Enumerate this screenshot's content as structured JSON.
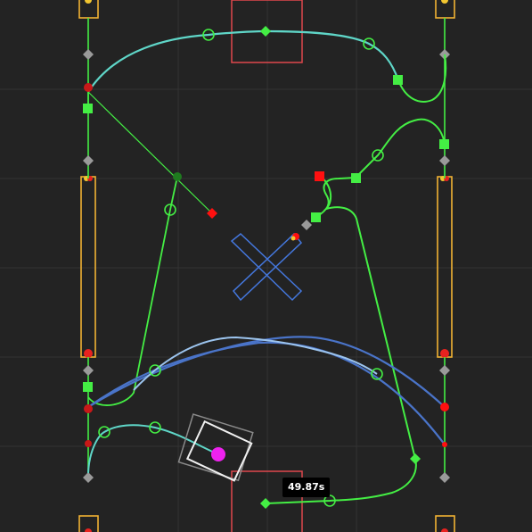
{
  "timer": {
    "label": "49.87s"
  },
  "colors": {
    "background": "#232323",
    "grid": "#333333",
    "path_main": "#44ee44",
    "path_teal": "#5fd6c8",
    "path_blue": "#4a74c9",
    "path_lightblue": "#9cc4ee",
    "lane_orange": "#f2b233",
    "goal_red": "#e0474c",
    "marker_red": "#ff1010",
    "robot_magenta": "#ee22ee",
    "node_gray": "#9a9a9a",
    "target_x_blue": "#4477dd"
  },
  "legend_icons": [
    "waypoint-ring-icon",
    "waypoint-square-icon",
    "waypoint-diamond-icon",
    "start-marker-icon",
    "robot-icon",
    "target-x-icon"
  ]
}
